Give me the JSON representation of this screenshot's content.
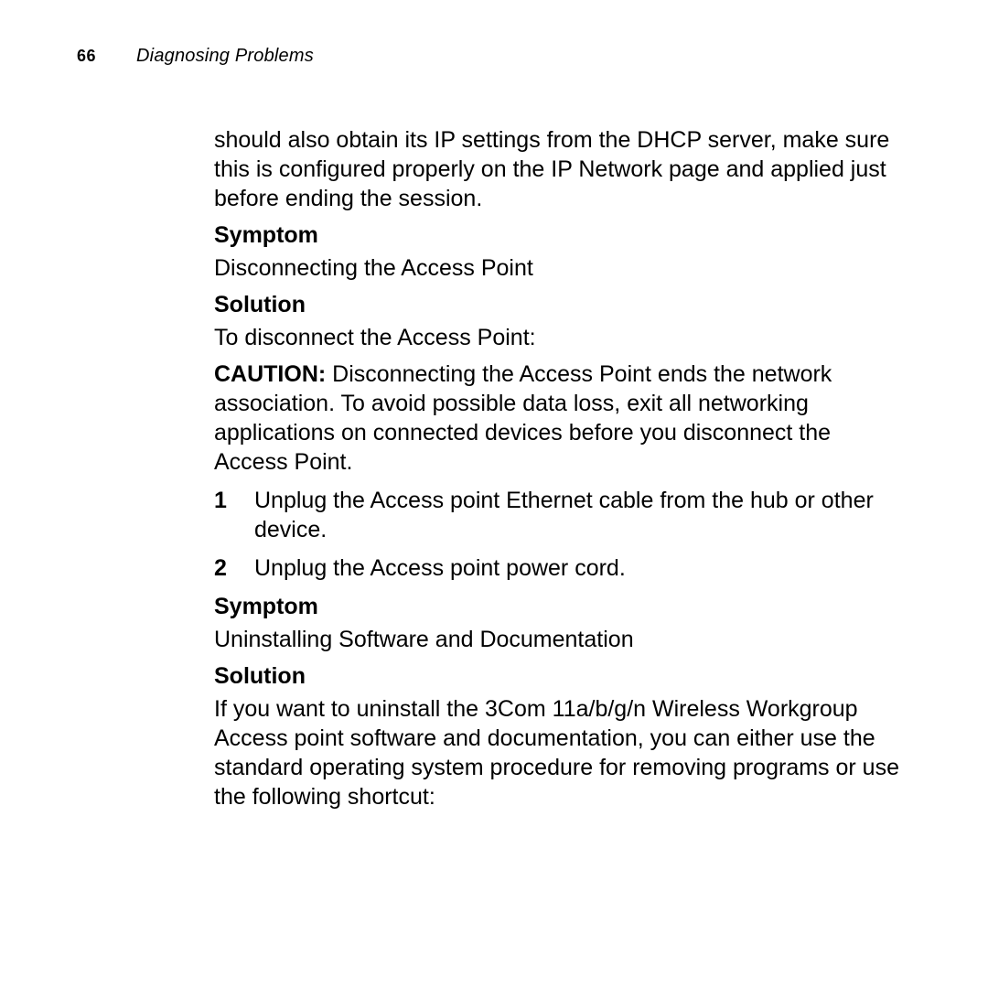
{
  "page_number": "66",
  "chapter": "Diagnosing Problems",
  "intro_paragraph": "should also obtain its IP settings from the DHCP server, make sure this is configured properly on the IP Network page and applied just before ending the session.",
  "section1": {
    "symptom_label": "Symptom",
    "symptom_text": "Disconnecting the Access Point",
    "solution_label": "Solution",
    "solution_intro": "To disconnect the Access Point:",
    "caution_label": "CAUTION:",
    "caution_text": " Disconnecting the Access Point ends the network association. To avoid possible data loss, exit all networking applications on connected devices before you disconnect the Access Point.",
    "steps": [
      "Unplug the Access point Ethernet cable from the hub or other device.",
      "Unplug the Access point power cord."
    ]
  },
  "section2": {
    "symptom_label": "Symptom",
    "symptom_text": "Uninstalling Software and Documentation",
    "solution_label": "Solution",
    "solution_text": "If you want to uninstall the 3Com 11a/b/g/n Wireless Workgroup Access point software and documentation, you can either use the standard operating system procedure for removing programs or use the following shortcut:"
  }
}
